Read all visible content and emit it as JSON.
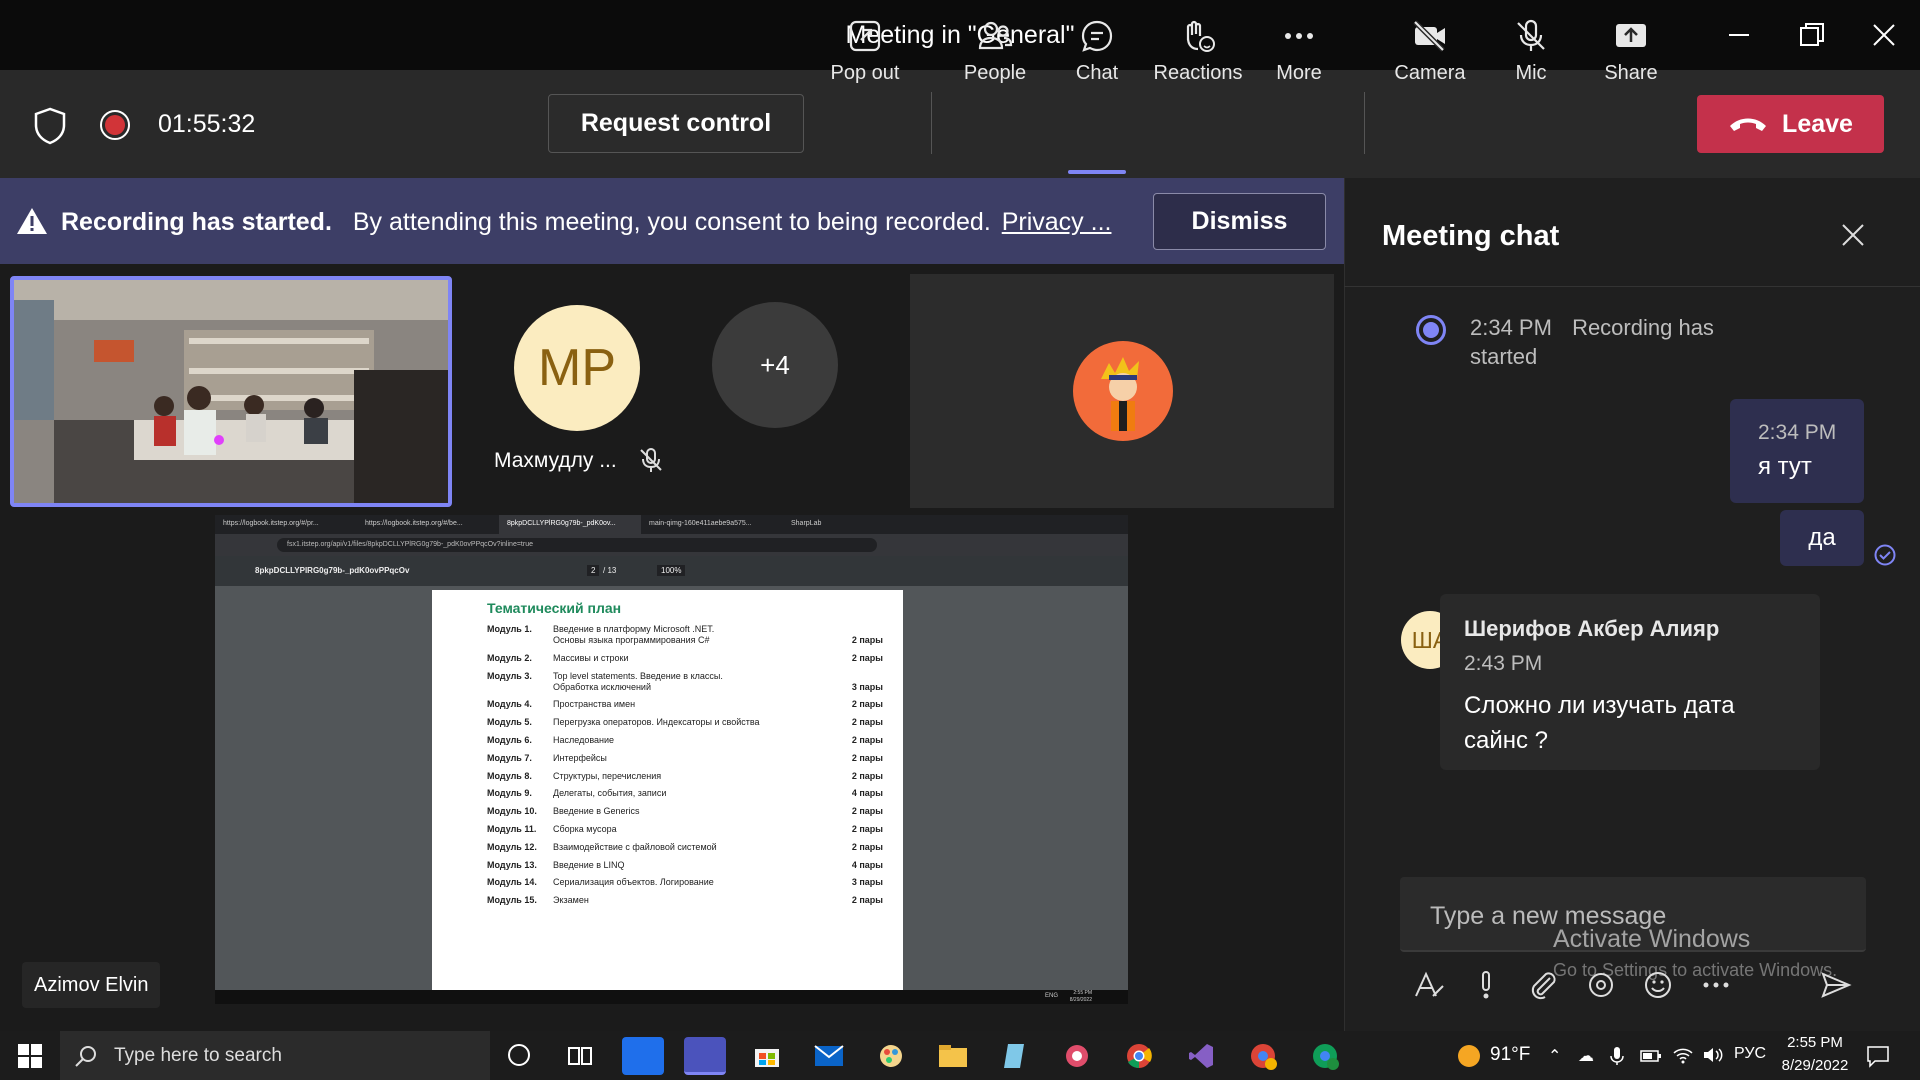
{
  "window": {
    "title": "Meeting in \"General\""
  },
  "toolbar": {
    "timer": "01:55:32",
    "request_control": "Request control",
    "pop_out": "Pop out",
    "people": "People",
    "chat": "Chat",
    "reactions": "Reactions",
    "more": "More",
    "camera": "Camera",
    "mic": "Mic",
    "share": "Share",
    "leave": "Leave"
  },
  "banner": {
    "title": "Recording has started.",
    "message": "By attending this meeting, you consent to being recorded.",
    "link": "Privacy ...",
    "dismiss": "Dismiss"
  },
  "participants": {
    "mp_initials": "MP",
    "mp_name": "Махмудлу ...",
    "overflow": "+4",
    "presenter_name": "Azimov Elvin"
  },
  "shared_screen": {
    "tabs": [
      "https://logbook.itstep.org/#/pr...",
      "https://logbook.itstep.org/#/be...",
      "8pkpDCLLYPlRG0g79b-_pdK0ov...",
      "main-qimg-160e411aebe9a575...",
      "SharpLab"
    ],
    "address": "fsx1.itstep.org/api/v1/files/8pkpDCLLYPlRG0g79b-_pdK0ovPPqcOv?inline=true",
    "pdf_name": "8pkpDCLLYPlRG0g79b-_pdK0ovPPqcOv",
    "page": "2",
    "pages": "/ 13",
    "zoom": "100%",
    "doc_title": "Тематический план",
    "modules": [
      {
        "num": "Модуль 1.",
        "text": "Введение в платформу Microsoft .NET.",
        "text2": "Основы языка программирования C#",
        "pairs": "2 пары"
      },
      {
        "num": "Модуль 2.",
        "text": "Массивы и строки",
        "pairs": "2 пары"
      },
      {
        "num": "Модуль 3.",
        "text": "Top level statements. Введение в классы.",
        "text2": "Обработка исключений",
        "pairs": "3 пары"
      },
      {
        "num": "Модуль 4.",
        "text": "Пространства имен",
        "pairs": "2 пары"
      },
      {
        "num": "Модуль 5.",
        "text": "Перегрузка операторов. Индексаторы и свойства",
        "pairs": "2 пары"
      },
      {
        "num": "Модуль 6.",
        "text": "Наследование",
        "pairs": "2 пары"
      },
      {
        "num": "Модуль 7.",
        "text": "Интерфейсы",
        "pairs": "2 пары"
      },
      {
        "num": "Модуль 8.",
        "text": "Структуры, перечисления",
        "pairs": "2 пары"
      },
      {
        "num": "Модуль 9.",
        "text": "Делегаты, события, записи",
        "pairs": "4 пары"
      },
      {
        "num": "Модуль 10.",
        "text": "Введение в Generics",
        "pairs": "2 пары"
      },
      {
        "num": "Модуль 11.",
        "text": "Сборка мусора",
        "pairs": "2 пары"
      },
      {
        "num": "Модуль 12.",
        "text": "Взаимодействие с файловой системой",
        "pairs": "2 пары"
      },
      {
        "num": "Модуль 13.",
        "text": "Введение в LINQ",
        "pairs": "4 пары"
      },
      {
        "num": "Модуль 14.",
        "text": "Сериализация объектов. Логирование",
        "pairs": "3 пары"
      },
      {
        "num": "Модуль 15.",
        "text": "Экзамен",
        "pairs": "2 пары"
      }
    ],
    "clock_time": "2:55 PM",
    "clock_date": "8/29/2022",
    "lang": "ENG"
  },
  "chat": {
    "header": "Meeting chat",
    "system_time": "2:34 PM",
    "system_text": "Recording has started",
    "my_time": "2:34 PM",
    "my_msg1": "я тут",
    "my_msg2": "да",
    "other_initials": "ША",
    "other_name": "Шерифов Акбер Алияр",
    "other_time": "2:43 PM",
    "other_msg": "Сложно ли изучать дата сайнс ?",
    "input_placeholder": "Type a new message"
  },
  "watermark": {
    "line1": "Activate Windows",
    "line2": "Go to Settings to activate Windows."
  },
  "taskbar": {
    "search_placeholder": "Type here to search",
    "weather": "91°F",
    "lang": "РУС",
    "time": "2:55 PM",
    "date": "8/29/2022"
  },
  "colors": {
    "accent": "#7f85f5",
    "leave": "#c4314b",
    "banner": "#3d3e66",
    "bubble": "#2e2f4f"
  }
}
